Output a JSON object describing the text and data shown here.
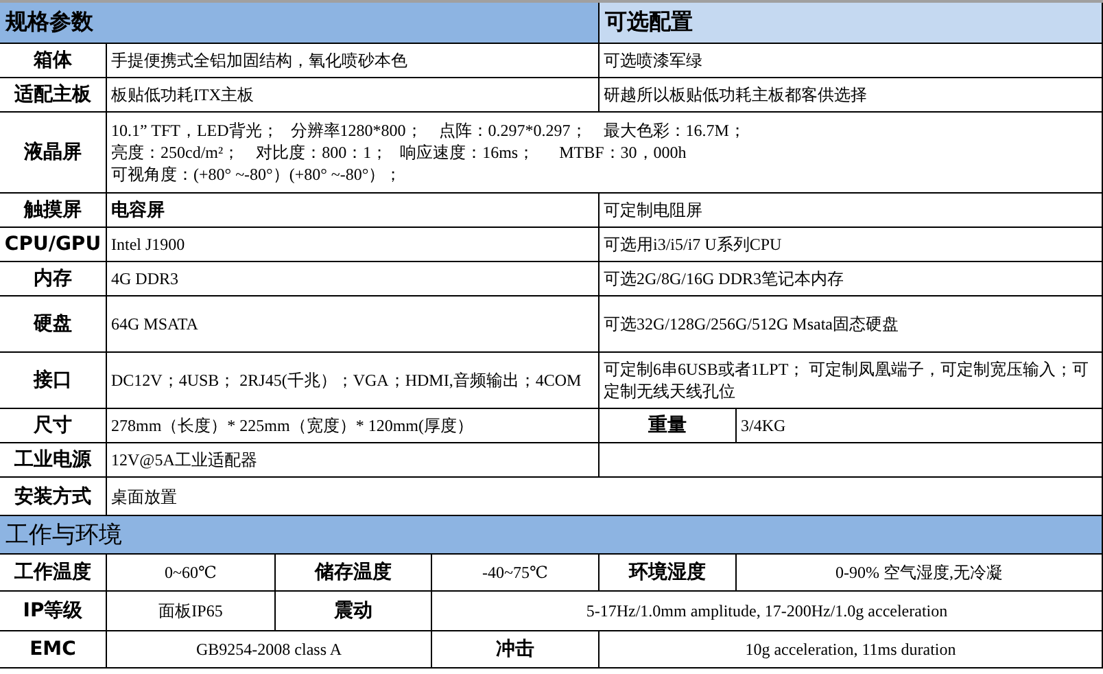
{
  "sections": [
    {
      "title": "规格参数",
      "option_title": "可选配置",
      "rows": [
        {
          "kind": "spec",
          "label": "箱体",
          "value": "手提便携式全铝加固结构，氧化喷砂本色",
          "value_bold": false,
          "option": "可选喷漆军绿"
        },
        {
          "kind": "spec",
          "label": "适配主板",
          "value": "板贴低功耗ITX主板",
          "value_bold": false,
          "option": "研越所以板贴低功耗主板都客供选择"
        },
        {
          "kind": "full",
          "label": "液晶屏",
          "lines": [
            "10.1” TFT，LED背光；   分辨率1280*800；    点阵：0.297*0.297；    最大色彩：16.7M；",
            "亮度：250cd/m²；    对比度：800：1；   响应速度：16ms；      MTBF：30，000h",
            "可视角度：(+80° ~-80°）(+80° ~-80°）；"
          ]
        },
        {
          "kind": "spec",
          "label": "触摸屏",
          "value": "电容屏",
          "value_bold": true,
          "option": "可定制电阻屏"
        },
        {
          "kind": "spec",
          "label": "CPU/GPU",
          "value": "Intel J1900",
          "value_bold": false,
          "option": "可选用i3/i5/i7 U系列CPU"
        },
        {
          "kind": "spec",
          "label": "内存",
          "value": "4G DDR3",
          "value_bold": false,
          "option": "可选2G/8G/16G DDR3笔记本内存"
        },
        {
          "kind": "spec",
          "label": "硬盘",
          "value": "64G MSATA",
          "value_bold": false,
          "option": "可选32G/128G/256G/512G Msata固态硬盘"
        },
        {
          "kind": "spec",
          "label": "接口",
          "value": "DC12V；4USB； 2RJ45(千兆）；VGA；HDMI,音频输出；4COM",
          "value_bold": false,
          "option": "可定制6串6USB或者1LPT； 可定制凤凰端子，可定制宽压输入；可定制无线天线孔位"
        },
        {
          "kind": "weight",
          "label": "尺寸",
          "value": "278mm（长度）* 225mm（宽度）* 120mm(厚度）",
          "label2": "重量",
          "value2": "3/4KG"
        },
        {
          "kind": "spec",
          "label": "工业电源",
          "value": "12V@5A工业适配器",
          "value_bold": false
        },
        {
          "kind": "full",
          "label": "安装方式",
          "lines": [
            "桌面放置"
          ]
        }
      ]
    },
    {
      "title": "工作与环境",
      "rows": [
        {
          "kind": "env3",
          "cells": [
            "工作温度",
            "0~60℃",
            "储存温度",
            "-40~75℃",
            "环境湿度",
            "0-90% 空气湿度,无冷凝"
          ]
        },
        {
          "kind": "env_vib",
          "cells": [
            "IP等级",
            "面板IP65",
            "震动",
            "5-17Hz/1.0mm amplitude, 17-200Hz/1.0g acceleration"
          ]
        },
        {
          "kind": "env_emc",
          "cells": [
            "EMC",
            "GB9254-2008 class A",
            "冲击",
            "10g acceleration, 11ms duration"
          ]
        }
      ]
    }
  ]
}
